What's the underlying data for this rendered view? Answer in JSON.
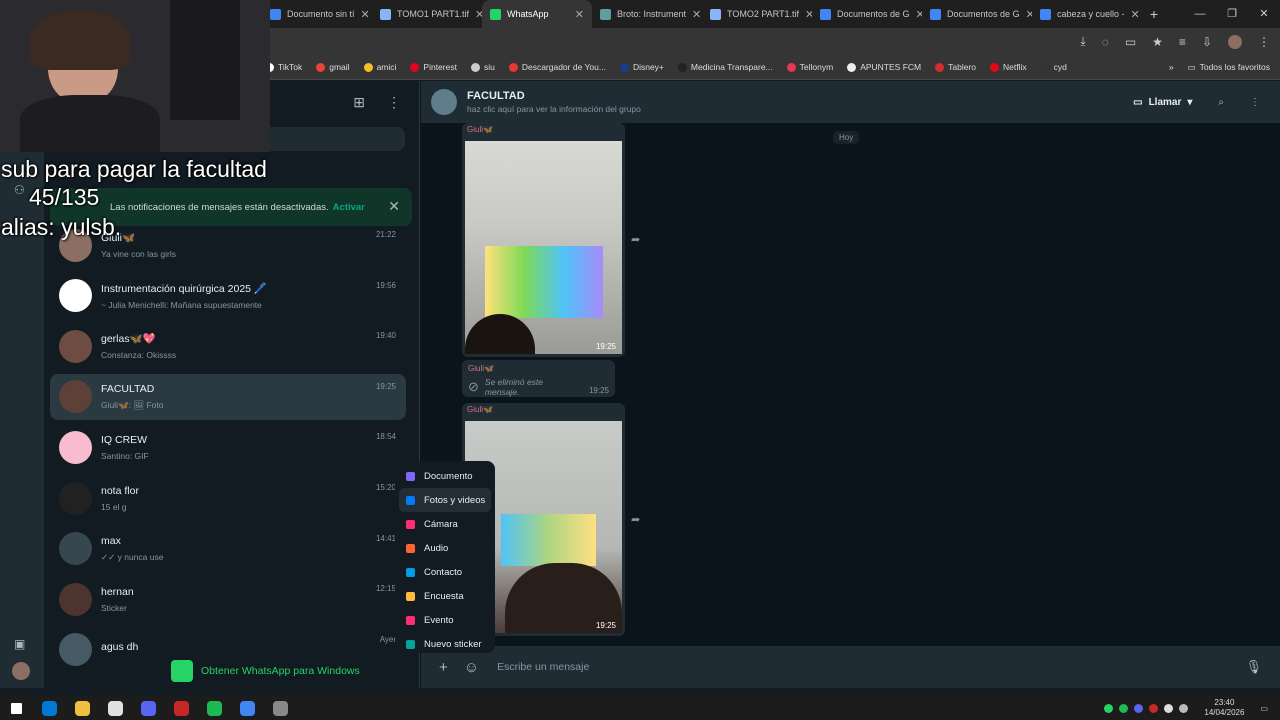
{
  "browser": {
    "tabs": [
      {
        "title": "Documento sin tí",
        "color": "#4285f4",
        "active": false
      },
      {
        "title": "TOMO1 PART1.tif",
        "color": "#8ab4f8",
        "active": false
      },
      {
        "title": "WhatsApp",
        "color": "#25d366",
        "active": true
      },
      {
        "title": "Broto: Instrument",
        "color": "#5f9ea0",
        "active": false
      },
      {
        "title": "TOMO2 PART1.tif",
        "color": "#8ab4f8",
        "active": false
      },
      {
        "title": "Documentos de G",
        "color": "#4285f4",
        "active": false
      },
      {
        "title": "Documentos de G",
        "color": "#4285f4",
        "active": false
      },
      {
        "title": "cabeza y cuello -",
        "color": "#4285f4",
        "active": false
      }
    ],
    "new_tab": "+",
    "bookmarks": [
      {
        "label": "TikTok",
        "color": "#ffffff"
      },
      {
        "label": "gmail",
        "color": "#ea4335"
      },
      {
        "label": "amici",
        "color": "#f6bf26"
      },
      {
        "label": "Pinterest",
        "color": "#e60023"
      },
      {
        "label": "siu",
        "color": "#cccccc"
      },
      {
        "label": "Descargador de You...",
        "color": "#e53935"
      },
      {
        "label": "Disney+",
        "color": "#1a3c8f"
      },
      {
        "label": "Medicina Transpare...",
        "color": "#222222"
      },
      {
        "label": "Tellonym",
        "color": "#e53950"
      },
      {
        "label": "APUNTES FCM",
        "color": "#eeeeee"
      },
      {
        "label": "Tablero",
        "color": "#d32f2f"
      },
      {
        "label": "Netflix",
        "color": "#e50914"
      },
      {
        "label": "cyd",
        "color": "#333333"
      }
    ],
    "bookmarks_more": "»",
    "all_bookmarks": "Todos los favoritos"
  },
  "stream_overlay": {
    "line1": "sub para pagar la facultad",
    "line2": "45/135",
    "line3": "alias: yulsb."
  },
  "sidebar": {
    "notification": {
      "text": "Las notificaciones de mensajes están desactivadas.",
      "action": "Activar"
    },
    "chats": [
      {
        "name": "Giuli🦋",
        "preview": "Ya vine con las girls",
        "time": "21:22",
        "avatar": "#8d6e63"
      },
      {
        "name": "Instrumentación quirúrgica 2025 🖊️",
        "preview": "~ Julia Menichelli: Mañana supuestamente",
        "time": "19:56",
        "avatar": "#ffffff"
      },
      {
        "name": "gerlas🦋💖",
        "preview": "Constanza: Okissss",
        "time": "19:40",
        "avatar": "#6d4c41"
      },
      {
        "name": "FACULTAD",
        "preview": "Giuli🦋: 🖼 Foto",
        "time": "19:25",
        "avatar": "#5d4037",
        "selected": true
      },
      {
        "name": "IQ CREW",
        "preview": "Santino: GIF",
        "time": "18:54",
        "avatar": "#f8bbd0"
      },
      {
        "name": "nota flor",
        "preview": "15 el g",
        "time": "15:20",
        "avatar": "#212121"
      },
      {
        "name": "max",
        "preview": "✓✓ y nunca use",
        "time": "14:41",
        "avatar": "#37474f"
      },
      {
        "name": "hernan",
        "preview": "Sticker",
        "time": "12:15",
        "avatar": "#4e342e"
      },
      {
        "name": "agus dh",
        "preview": "",
        "time": "Ayer",
        "avatar": "#455a64"
      }
    ],
    "get_windows": "Obtener WhatsApp para Windows"
  },
  "conversation": {
    "title": "FACULTAD",
    "subtitle": "haz clic aquí para ver la información del grupo",
    "call_label": "Llamar",
    "day_label": "Hoy",
    "sender": "Giuli🦋",
    "photo1_time": "19:25",
    "deleted_text": "Se eliminó este mensaje.",
    "deleted_time": "19:25",
    "photo2_time": "19:25",
    "composer_placeholder": "Escribe un mensaje"
  },
  "attach_menu": [
    {
      "label": "Documento",
      "color": "#7f66ff"
    },
    {
      "label": "Fotos y videos",
      "color": "#007bfc"
    },
    {
      "label": "Cámara",
      "color": "#ff2e74"
    },
    {
      "label": "Audio",
      "color": "#fa6533"
    },
    {
      "label": "Contacto",
      "color": "#009de2"
    },
    {
      "label": "Encuesta",
      "color": "#ffbc38"
    },
    {
      "label": "Evento",
      "color": "#ff2e74"
    },
    {
      "label": "Nuevo sticker",
      "color": "#02a698"
    }
  ],
  "taskbar": {
    "apps": [
      "#0078d4",
      "#f0c040",
      "#e0e0e0",
      "#5865f2",
      "#c62828",
      "#1db954",
      "#4285f4",
      "#888888"
    ],
    "time": "23:40",
    "date": "14/04/2026"
  },
  "colors": {
    "accent": "#00a884",
    "panel": "#202c33",
    "background": "#0b141a"
  }
}
